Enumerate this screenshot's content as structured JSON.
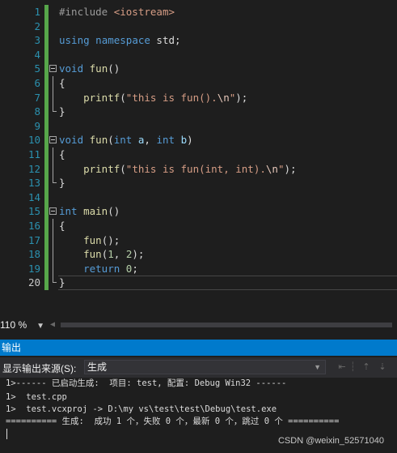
{
  "editor": {
    "lines": [
      {
        "n": "1",
        "code": [
          {
            "t": "#include ",
            "c": "pp"
          },
          {
            "t": "<iostream>",
            "c": "inc"
          }
        ]
      },
      {
        "n": "2",
        "code": []
      },
      {
        "n": "3",
        "code": [
          {
            "t": "using",
            "c": "kw"
          },
          {
            "t": " "
          },
          {
            "t": "namespace",
            "c": "kw"
          },
          {
            "t": " std;"
          }
        ]
      },
      {
        "n": "4",
        "code": []
      },
      {
        "n": "5",
        "code": [
          {
            "t": "void",
            "c": "kw"
          },
          {
            "t": " "
          },
          {
            "t": "fun",
            "c": "fn"
          },
          {
            "t": "()"
          }
        ]
      },
      {
        "n": "6",
        "code": [
          {
            "t": "{"
          }
        ]
      },
      {
        "n": "7",
        "code": [
          {
            "t": "    "
          },
          {
            "t": "printf",
            "c": "fn"
          },
          {
            "t": "("
          },
          {
            "t": "\"this is fun().",
            "c": "str"
          },
          {
            "t": "\\n",
            "c": "esc"
          },
          {
            "t": "\"",
            "c": "str"
          },
          {
            "t": ");"
          }
        ]
      },
      {
        "n": "8",
        "code": [
          {
            "t": "}"
          }
        ]
      },
      {
        "n": "9",
        "code": []
      },
      {
        "n": "10",
        "code": [
          {
            "t": "void",
            "c": "kw"
          },
          {
            "t": " "
          },
          {
            "t": "fun",
            "c": "fn"
          },
          {
            "t": "("
          },
          {
            "t": "int",
            "c": "kw"
          },
          {
            "t": " "
          },
          {
            "t": "a",
            "c": "par"
          },
          {
            "t": ", "
          },
          {
            "t": "int",
            "c": "kw"
          },
          {
            "t": " "
          },
          {
            "t": "b",
            "c": "par"
          },
          {
            "t": ")"
          }
        ]
      },
      {
        "n": "11",
        "code": [
          {
            "t": "{"
          }
        ]
      },
      {
        "n": "12",
        "code": [
          {
            "t": "    "
          },
          {
            "t": "printf",
            "c": "fn"
          },
          {
            "t": "("
          },
          {
            "t": "\"this is fun(int, int).",
            "c": "str"
          },
          {
            "t": "\\n",
            "c": "esc"
          },
          {
            "t": "\"",
            "c": "str"
          },
          {
            "t": ");"
          }
        ]
      },
      {
        "n": "13",
        "code": [
          {
            "t": "}"
          }
        ]
      },
      {
        "n": "14",
        "code": []
      },
      {
        "n": "15",
        "code": [
          {
            "t": "int",
            "c": "kw"
          },
          {
            "t": " "
          },
          {
            "t": "main",
            "c": "fn"
          },
          {
            "t": "()"
          }
        ]
      },
      {
        "n": "16",
        "code": [
          {
            "t": "{"
          }
        ]
      },
      {
        "n": "17",
        "code": [
          {
            "t": "    "
          },
          {
            "t": "fun",
            "c": "fn"
          },
          {
            "t": "();"
          }
        ]
      },
      {
        "n": "18",
        "code": [
          {
            "t": "    "
          },
          {
            "t": "fun",
            "c": "fn"
          },
          {
            "t": "("
          },
          {
            "t": "1",
            "c": "num"
          },
          {
            "t": ", "
          },
          {
            "t": "2",
            "c": "num"
          },
          {
            "t": ");"
          }
        ]
      },
      {
        "n": "19",
        "code": [
          {
            "t": "    "
          },
          {
            "t": "return",
            "c": "kw"
          },
          {
            "t": " "
          },
          {
            "t": "0",
            "c": "num"
          },
          {
            "t": ";"
          }
        ]
      },
      {
        "n": "20",
        "code": [
          {
            "t": "}"
          }
        ]
      }
    ],
    "fold_starts": [
      "5",
      "10",
      "15"
    ],
    "fold_middles": [
      "6",
      "7",
      "11",
      "12",
      "16",
      "17",
      "18",
      "19"
    ],
    "fold_ends": [
      "8",
      "13",
      "20"
    ],
    "current_line": "20"
  },
  "status": {
    "zoom": "110 %"
  },
  "output": {
    "title": "输出",
    "source_label": "显示输出来源(S):",
    "source_value": "生成",
    "lines": [
      "1>------ 已启动生成:  项目: test, 配置: Debug Win32 ------",
      "1>  test.cpp",
      "1>  test.vcxproj -> D:\\my vs\\test\\test\\Debug\\test.exe",
      "========== 生成:  成功 1 个，失败 0 个，最新 0 个，跳过 0 个 =========="
    ]
  },
  "watermark": "CSDN @weixin_52571040"
}
